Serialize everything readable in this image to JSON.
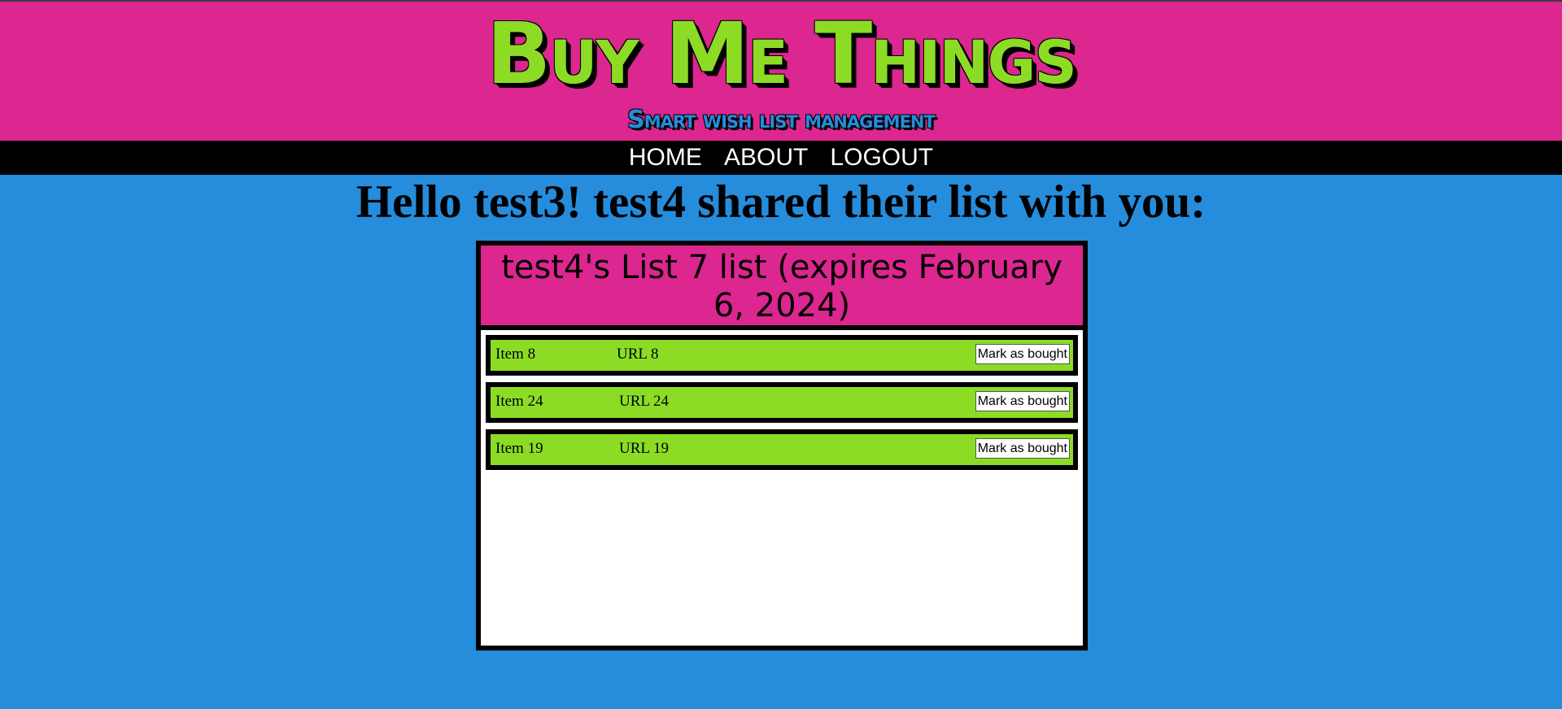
{
  "colors": {
    "background": "#268cdc",
    "header": "#dc2690",
    "accent_green": "#8cdc26",
    "nav": "#000000"
  },
  "header": {
    "title": "Buy Me Things",
    "tagline": "Smart wish list management"
  },
  "nav": {
    "items": [
      {
        "label": "HOME"
      },
      {
        "label": "ABOUT"
      },
      {
        "label": "LOGOUT"
      }
    ]
  },
  "main": {
    "greeting": "Hello test3! test4 shared their list with you:",
    "list": {
      "title_line1": "test4's List 7 list (expires February",
      "title_line2": "6, 2024)",
      "items": [
        {
          "name": "Item 8",
          "url": "URL 8",
          "action": "Mark as bought"
        },
        {
          "name": "Item 24",
          "url": "URL 24",
          "action": "Mark as bought"
        },
        {
          "name": "Item 19",
          "url": "URL 19",
          "action": "Mark as bought"
        }
      ]
    }
  }
}
